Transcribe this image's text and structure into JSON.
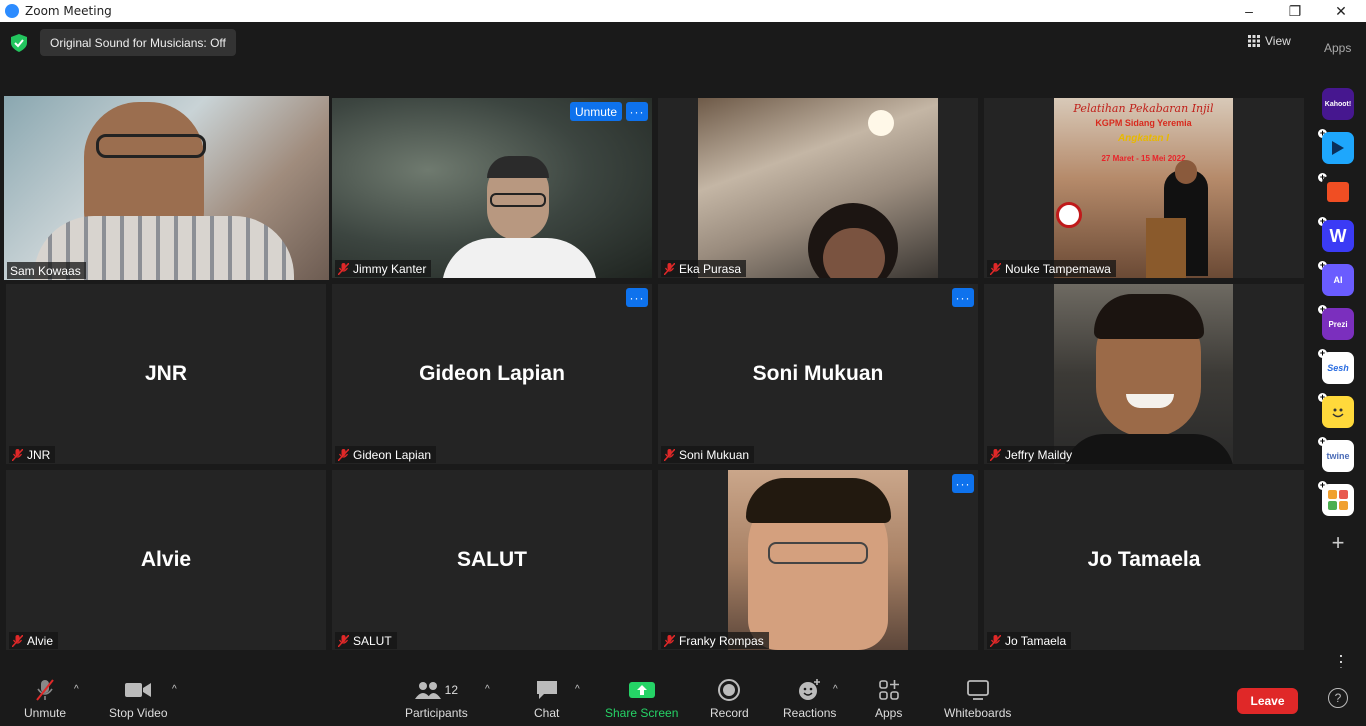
{
  "window": {
    "title": "Zoom Meeting",
    "minimize": "–",
    "maximize": "❐",
    "close": "✕"
  },
  "topbar": {
    "original_sound": "Original Sound for Musicians: Off",
    "view_label": "View",
    "apps_label": "Apps"
  },
  "participants": [
    {
      "name": "Sam Kowaas",
      "display": "",
      "video": true,
      "muted": false,
      "active": true
    },
    {
      "name": "Jimmy Kanter",
      "display": "",
      "video": true,
      "muted": true,
      "unmute_label": "Unmute",
      "more": "···"
    },
    {
      "name": "Eka Purasa",
      "display": "",
      "video": true,
      "muted": true
    },
    {
      "name": "Nouke Tampemawa",
      "display": "",
      "video": true,
      "muted": true,
      "poster": {
        "line1": "Pelatihan Pekabaran Injil",
        "line2": "KGPM Sidang Yeremia",
        "line3": "Angkatan I",
        "line4": "27 Maret - 15 Mei 2022"
      }
    },
    {
      "name": "JNR",
      "display": "JNR",
      "video": false,
      "muted": true
    },
    {
      "name": "Gideon Lapian",
      "display": "Gideon Lapian",
      "video": false,
      "muted": true,
      "more": "···"
    },
    {
      "name": "Soni Mukuan",
      "display": "Soni Mukuan",
      "video": false,
      "muted": true,
      "more": "···"
    },
    {
      "name": "Jeffry Maildy",
      "display": "",
      "video": true,
      "muted": true
    },
    {
      "name": "Alvie",
      "display": "Alvie",
      "video": false,
      "muted": true
    },
    {
      "name": "SALUT",
      "display": "SALUT",
      "video": false,
      "muted": true
    },
    {
      "name": "Franky Rompas",
      "display": "",
      "video": true,
      "muted": true,
      "more": "···"
    },
    {
      "name": "Jo Tamaela",
      "display": "Jo Tamaela",
      "video": false,
      "muted": true
    }
  ],
  "apps_sidebar": [
    {
      "name": "kahoot",
      "label": "Kahoot!",
      "color": "#46178f"
    },
    {
      "name": "app2",
      "label": "",
      "color": "#1ea7fd"
    },
    {
      "name": "app3",
      "label": "",
      "color": "#f04e23"
    },
    {
      "name": "wooclap",
      "label": "W",
      "color": "#3b3bf5"
    },
    {
      "name": "app5",
      "label": "AI",
      "color": "#6a5cff"
    },
    {
      "name": "prezi",
      "label": "Prezi",
      "color": "#7b2fbe"
    },
    {
      "name": "sesh",
      "label": "Sesh",
      "color": "#ffffff"
    },
    {
      "name": "app8",
      "label": "",
      "color": "#ffd93b"
    },
    {
      "name": "twine",
      "label": "twine",
      "color": "#ffffff"
    },
    {
      "name": "app10",
      "label": "",
      "color": "#ffffff"
    }
  ],
  "toolbar": {
    "unmute": "Unmute",
    "stop_video": "Stop Video",
    "participants": "Participants",
    "participant_count": "12",
    "chat": "Chat",
    "share_screen": "Share Screen",
    "record": "Record",
    "reactions": "Reactions",
    "apps": "Apps",
    "whiteboards": "Whiteboards",
    "leave": "Leave",
    "caret": "^",
    "more": "⋮",
    "help": "?"
  },
  "colors": {
    "active_speaker": "#e0e36a",
    "accent": "#0e72ed",
    "share_green": "#25d366",
    "leave_red": "#e02828"
  }
}
